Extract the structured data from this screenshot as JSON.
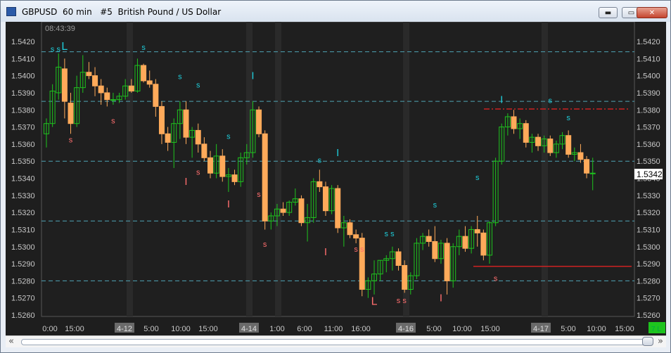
{
  "window": {
    "title": "GBPUSD  60 min   #5  British Pound / US Dollar",
    "buttons": {
      "minimize": "▬",
      "restore": "▭",
      "close": "✕"
    }
  },
  "chart_data": {
    "type": "candlestick",
    "title": "GBPUSD  60 min   #5  British Pound / US Dollar",
    "timestamp": "08:43:39",
    "current_price": "1.5342",
    "corner_label": "7 L",
    "ylim": [
      1.5255,
      1.5425
    ],
    "y_ticks": [
      "1.5420",
      "1.5410",
      "1.5400",
      "1.5390",
      "1.5380",
      "1.5370",
      "1.5360",
      "1.5350",
      "1.5340",
      "1.5330",
      "1.5320",
      "1.5310",
      "1.5300",
      "1.5290",
      "1.5280",
      "1.5270",
      "1.5260"
    ],
    "x_ticks": [
      "0:00",
      "15:00",
      "4-12",
      "5:00",
      "10:00",
      "15:00",
      "4-14",
      "1:00",
      "6:00",
      "11:00",
      "16:00",
      "4-16",
      "5:00",
      "10:00",
      "15:00",
      "4-17",
      "5:00",
      "10:00",
      "15:00"
    ],
    "date_ticks": [
      "4-12",
      "4-14",
      "4-16",
      "4-17"
    ],
    "grid": true,
    "colors": {
      "up": "#1ec41e",
      "down": "#ffaa5a",
      "up_label": "#1ecbd8",
      "down_label": "#ff6e6e",
      "background": "#1f1f1f",
      "level_line": "#4fa3b5",
      "resistance": "#cc2222"
    },
    "levels": [
      1.5414,
      1.5385,
      1.535,
      1.5315,
      1.528
    ],
    "resistance": 1.53805,
    "support": 1.52885,
    "candles": [
      {
        "o": 1.5366,
        "h": 1.5375,
        "l": 1.5358,
        "c": 1.5372
      },
      {
        "o": 1.5372,
        "h": 1.5395,
        "l": 1.537,
        "c": 1.5391
      },
      {
        "o": 1.539,
        "h": 1.5413,
        "l": 1.5386,
        "c": 1.5405
      },
      {
        "o": 1.5404,
        "h": 1.541,
        "l": 1.5375,
        "c": 1.5385
      },
      {
        "o": 1.5384,
        "h": 1.539,
        "l": 1.5366,
        "c": 1.5372
      },
      {
        "o": 1.5372,
        "h": 1.54,
        "l": 1.537,
        "c": 1.5393
      },
      {
        "o": 1.5393,
        "h": 1.5412,
        "l": 1.539,
        "c": 1.5402
      },
      {
        "o": 1.5402,
        "h": 1.5408,
        "l": 1.5398,
        "c": 1.54
      },
      {
        "o": 1.54,
        "h": 1.5405,
        "l": 1.5388,
        "c": 1.5394
      },
      {
        "o": 1.5394,
        "h": 1.5398,
        "l": 1.5383,
        "c": 1.539
      },
      {
        "o": 1.539,
        "h": 1.5393,
        "l": 1.5382,
        "c": 1.5386
      },
      {
        "o": 1.5386,
        "h": 1.539,
        "l": 1.5383,
        "c": 1.5386
      },
      {
        "o": 1.5386,
        "h": 1.539,
        "l": 1.5384,
        "c": 1.5388
      },
      {
        "o": 1.5388,
        "h": 1.5398,
        "l": 1.5386,
        "c": 1.5394
      },
      {
        "o": 1.5394,
        "h": 1.5398,
        "l": 1.539,
        "c": 1.5391
      },
      {
        "o": 1.5391,
        "h": 1.541,
        "l": 1.539,
        "c": 1.5406
      },
      {
        "o": 1.5406,
        "h": 1.5407,
        "l": 1.5396,
        "c": 1.5397
      },
      {
        "o": 1.5397,
        "h": 1.5403,
        "l": 1.5393,
        "c": 1.5395
      },
      {
        "o": 1.5395,
        "h": 1.5398,
        "l": 1.5376,
        "c": 1.5382
      },
      {
        "o": 1.5382,
        "h": 1.5385,
        "l": 1.536,
        "c": 1.5366
      },
      {
        "o": 1.5366,
        "h": 1.537,
        "l": 1.5356,
        "c": 1.5361
      },
      {
        "o": 1.5361,
        "h": 1.5375,
        "l": 1.5346,
        "c": 1.5372
      },
      {
        "o": 1.5372,
        "h": 1.5385,
        "l": 1.5363,
        "c": 1.538
      },
      {
        "o": 1.538,
        "h": 1.5385,
        "l": 1.536,
        "c": 1.5364
      },
      {
        "o": 1.5364,
        "h": 1.537,
        "l": 1.5352,
        "c": 1.5368
      },
      {
        "o": 1.5368,
        "h": 1.5372,
        "l": 1.5355,
        "c": 1.536
      },
      {
        "o": 1.536,
        "h": 1.5364,
        "l": 1.535,
        "c": 1.5352
      },
      {
        "o": 1.5352,
        "h": 1.5356,
        "l": 1.534,
        "c": 1.5343
      },
      {
        "o": 1.5343,
        "h": 1.536,
        "l": 1.534,
        "c": 1.5353
      },
      {
        "o": 1.5353,
        "h": 1.5357,
        "l": 1.5338,
        "c": 1.5341
      },
      {
        "o": 1.5341,
        "h": 1.5346,
        "l": 1.5332,
        "c": 1.5342
      },
      {
        "o": 1.5342,
        "h": 1.5345,
        "l": 1.5336,
        "c": 1.5338
      },
      {
        "o": 1.5338,
        "h": 1.5355,
        "l": 1.5335,
        "c": 1.5352
      },
      {
        "o": 1.5352,
        "h": 1.536,
        "l": 1.5348,
        "c": 1.5355
      },
      {
        "o": 1.5355,
        "h": 1.5385,
        "l": 1.5352,
        "c": 1.538
      },
      {
        "o": 1.538,
        "h": 1.5382,
        "l": 1.5364,
        "c": 1.5366
      },
      {
        "o": 1.5366,
        "h": 1.5368,
        "l": 1.531,
        "c": 1.5315
      },
      {
        "o": 1.5315,
        "h": 1.532,
        "l": 1.531,
        "c": 1.5318
      },
      {
        "o": 1.5318,
        "h": 1.5325,
        "l": 1.5312,
        "c": 1.5322
      },
      {
        "o": 1.5322,
        "h": 1.5326,
        "l": 1.5318,
        "c": 1.532
      },
      {
        "o": 1.532,
        "h": 1.5327,
        "l": 1.5318,
        "c": 1.5326
      },
      {
        "o": 1.5326,
        "h": 1.5334,
        "l": 1.5324,
        "c": 1.5328
      },
      {
        "o": 1.5328,
        "h": 1.533,
        "l": 1.5312,
        "c": 1.5314
      },
      {
        "o": 1.5314,
        "h": 1.5325,
        "l": 1.5303,
        "c": 1.5317
      },
      {
        "o": 1.5317,
        "h": 1.534,
        "l": 1.5314,
        "c": 1.5338
      },
      {
        "o": 1.5338,
        "h": 1.5345,
        "l": 1.5332,
        "c": 1.5335
      },
      {
        "o": 1.5335,
        "h": 1.5338,
        "l": 1.5318,
        "c": 1.5321
      },
      {
        "o": 1.5321,
        "h": 1.5336,
        "l": 1.5319,
        "c": 1.5334
      },
      {
        "o": 1.5334,
        "h": 1.5336,
        "l": 1.5308,
        "c": 1.5311
      },
      {
        "o": 1.5311,
        "h": 1.5318,
        "l": 1.53,
        "c": 1.5314
      },
      {
        "o": 1.5314,
        "h": 1.5316,
        "l": 1.5305,
        "c": 1.5307
      },
      {
        "o": 1.5307,
        "h": 1.531,
        "l": 1.5302,
        "c": 1.5305
      },
      {
        "o": 1.5305,
        "h": 1.5308,
        "l": 1.5271,
        "c": 1.5275
      },
      {
        "o": 1.5275,
        "h": 1.5282,
        "l": 1.527,
        "c": 1.528
      },
      {
        "o": 1.528,
        "h": 1.5292,
        "l": 1.5272,
        "c": 1.5284
      },
      {
        "o": 1.5284,
        "h": 1.5292,
        "l": 1.528,
        "c": 1.5292
      },
      {
        "o": 1.5292,
        "h": 1.5295,
        "l": 1.5285,
        "c": 1.5293
      },
      {
        "o": 1.5293,
        "h": 1.53,
        "l": 1.5286,
        "c": 1.5297
      },
      {
        "o": 1.5297,
        "h": 1.5299,
        "l": 1.5286,
        "c": 1.5289
      },
      {
        "o": 1.5289,
        "h": 1.5292,
        "l": 1.5273,
        "c": 1.5275
      },
      {
        "o": 1.5275,
        "h": 1.5285,
        "l": 1.5272,
        "c": 1.5283
      },
      {
        "o": 1.5283,
        "h": 1.5305,
        "l": 1.5281,
        "c": 1.5302
      },
      {
        "o": 1.5302,
        "h": 1.5308,
        "l": 1.5298,
        "c": 1.5306
      },
      {
        "o": 1.5306,
        "h": 1.531,
        "l": 1.53,
        "c": 1.5303
      },
      {
        "o": 1.5303,
        "h": 1.5312,
        "l": 1.5291,
        "c": 1.5293
      },
      {
        "o": 1.5293,
        "h": 1.5304,
        "l": 1.529,
        "c": 1.5302
      },
      {
        "o": 1.5302,
        "h": 1.5305,
        "l": 1.5272,
        "c": 1.528
      },
      {
        "o": 1.528,
        "h": 1.5302,
        "l": 1.5276,
        "c": 1.53
      },
      {
        "o": 1.53,
        "h": 1.531,
        "l": 1.5295,
        "c": 1.5306
      },
      {
        "o": 1.5306,
        "h": 1.5312,
        "l": 1.5297,
        "c": 1.5299
      },
      {
        "o": 1.5299,
        "h": 1.5312,
        "l": 1.5296,
        "c": 1.531
      },
      {
        "o": 1.531,
        "h": 1.5318,
        "l": 1.53,
        "c": 1.5308
      },
      {
        "o": 1.5308,
        "h": 1.531,
        "l": 1.5292,
        "c": 1.5295
      },
      {
        "o": 1.5295,
        "h": 1.5315,
        "l": 1.529,
        "c": 1.5314
      },
      {
        "o": 1.5314,
        "h": 1.5352,
        "l": 1.5312,
        "c": 1.535
      },
      {
        "o": 1.535,
        "h": 1.5372,
        "l": 1.5348,
        "c": 1.537
      },
      {
        "o": 1.537,
        "h": 1.5378,
        "l": 1.5365,
        "c": 1.5376
      },
      {
        "o": 1.5376,
        "h": 1.538,
        "l": 1.5366,
        "c": 1.5369
      },
      {
        "o": 1.5369,
        "h": 1.5375,
        "l": 1.5363,
        "c": 1.5372
      },
      {
        "o": 1.5372,
        "h": 1.5374,
        "l": 1.5358,
        "c": 1.5361
      },
      {
        "o": 1.5361,
        "h": 1.5366,
        "l": 1.5355,
        "c": 1.5364
      },
      {
        "o": 1.5364,
        "h": 1.5366,
        "l": 1.5356,
        "c": 1.5359
      },
      {
        "o": 1.5359,
        "h": 1.5365,
        "l": 1.5355,
        "c": 1.5363
      },
      {
        "o": 1.5363,
        "h": 1.5365,
        "l": 1.5353,
        "c": 1.5355
      },
      {
        "o": 1.5355,
        "h": 1.5362,
        "l": 1.5352,
        "c": 1.536
      },
      {
        "o": 1.536,
        "h": 1.5367,
        "l": 1.5357,
        "c": 1.5365
      },
      {
        "o": 1.5365,
        "h": 1.5368,
        "l": 1.5352,
        "c": 1.5354
      },
      {
        "o": 1.5354,
        "h": 1.5358,
        "l": 1.535,
        "c": 1.5355
      },
      {
        "o": 1.5355,
        "h": 1.536,
        "l": 1.5349,
        "c": 1.5351
      },
      {
        "o": 1.5351,
        "h": 1.5353,
        "l": 1.534,
        "c": 1.5343
      },
      {
        "o": 1.5343,
        "h": 1.5352,
        "l": 1.5333,
        "c": 1.5343
      }
    ],
    "markers": [
      {
        "i": 1,
        "t": "s",
        "side": "up",
        "y": 1.5414
      },
      {
        "i": 2,
        "t": "s",
        "side": "up",
        "y": 1.5414
      },
      {
        "i": 3,
        "t": "L",
        "side": "up",
        "y": 1.5415
      },
      {
        "i": 4,
        "t": "s",
        "side": "down",
        "y": 1.5361
      },
      {
        "i": 11,
        "t": "s",
        "side": "down",
        "y": 1.5372
      },
      {
        "i": 16,
        "t": "s",
        "side": "up",
        "y": 1.5415
      },
      {
        "i": 22,
        "t": "s",
        "side": "up",
        "y": 1.5398
      },
      {
        "i": 23,
        "t": "I",
        "side": "down",
        "y": 1.5336
      },
      {
        "i": 25,
        "t": "s",
        "side": "down",
        "y": 1.5342
      },
      {
        "i": 25,
        "t": "s",
        "side": "up",
        "y": 1.5393
      },
      {
        "i": 30,
        "t": "I",
        "side": "down",
        "y": 1.5323
      },
      {
        "i": 30,
        "t": "s",
        "side": "up",
        "y": 1.5363
      },
      {
        "i": 34,
        "t": "I",
        "side": "up",
        "y": 1.5398
      },
      {
        "i": 35,
        "t": "s",
        "side": "down",
        "y": 1.5329
      },
      {
        "i": 36,
        "t": "s",
        "side": "down",
        "y": 1.53
      },
      {
        "i": 45,
        "t": "s",
        "side": "up",
        "y": 1.5349
      },
      {
        "i": 46,
        "t": "I",
        "side": "down",
        "y": 1.5295
      },
      {
        "i": 48,
        "t": "I",
        "side": "up",
        "y": 1.5353
      },
      {
        "i": 51,
        "t": "s",
        "side": "down",
        "y": 1.5297
      },
      {
        "i": 52,
        "t": "s",
        "side": "down",
        "y": 1.5297
      },
      {
        "i": 54,
        "t": "L",
        "side": "down",
        "y": 1.5266
      },
      {
        "i": 56,
        "t": "s",
        "side": "up",
        "y": 1.5306
      },
      {
        "i": 57,
        "t": "s",
        "side": "up",
        "y": 1.5306
      },
      {
        "i": 58,
        "t": "s",
        "side": "down",
        "y": 1.5267
      },
      {
        "i": 59,
        "t": "s",
        "side": "down",
        "y": 1.5267
      },
      {
        "i": 64,
        "t": "s",
        "side": "up",
        "y": 1.5323
      },
      {
        "i": 65,
        "t": "I",
        "side": "down",
        "y": 1.5268
      },
      {
        "i": 71,
        "t": "s",
        "side": "up",
        "y": 1.5339
      },
      {
        "i": 74,
        "t": "s",
        "side": "down",
        "y": 1.528
      },
      {
        "i": 75,
        "t": "I",
        "side": "up",
        "y": 1.5384
      },
      {
        "i": 83,
        "t": "s",
        "side": "up",
        "y": 1.5384
      },
      {
        "i": 86,
        "t": "s",
        "side": "up",
        "y": 1.5374
      }
    ]
  }
}
